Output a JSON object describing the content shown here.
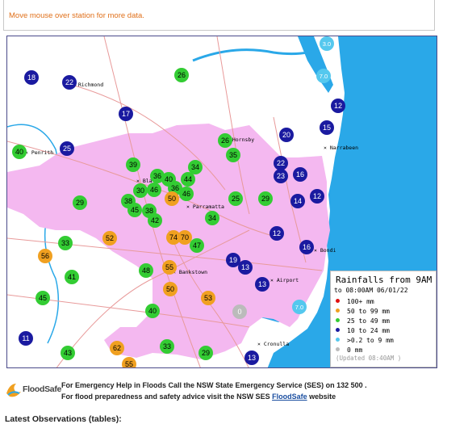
{
  "hint": "Move mouse over station for more data.",
  "map": {
    "places": [
      {
        "name": "Richmond",
        "label": "Richmond"
      },
      {
        "name": "Penrith",
        "label": "Penrith"
      },
      {
        "name": "Hornsby",
        "label": "Hornsby"
      },
      {
        "name": "Narrabeen",
        "label": "Narrabeen"
      },
      {
        "name": "Blacktown",
        "label": "Bla"
      },
      {
        "name": "Parramatta",
        "label": "Parramatta"
      },
      {
        "name": "Bankstown",
        "label": "Bankstown"
      },
      {
        "name": "Bondi",
        "label": "Bondi"
      },
      {
        "name": "Airport",
        "label": "Airport"
      },
      {
        "name": "Cronulla",
        "label": "Cronulla"
      }
    ],
    "stations": [
      {
        "value": "18",
        "category": "10-24"
      },
      {
        "value": "22",
        "category": "10-24"
      },
      {
        "value": "26",
        "category": "25-49"
      },
      {
        "value": "3.0",
        "category": "0.2-9"
      },
      {
        "value": "7.0",
        "category": "0.2-9"
      },
      {
        "value": "17",
        "category": "10-24"
      },
      {
        "value": "12",
        "category": "10-24"
      },
      {
        "value": "15",
        "category": "10-24"
      },
      {
        "value": "20",
        "category": "10-24"
      },
      {
        "value": "40",
        "category": "25-49"
      },
      {
        "value": "25",
        "category": "10-24"
      },
      {
        "value": "26",
        "category": "25-49"
      },
      {
        "value": "35",
        "category": "25-49"
      },
      {
        "value": "39",
        "category": "25-49"
      },
      {
        "value": "34",
        "category": "25-49"
      },
      {
        "value": "22",
        "category": "10-24"
      },
      {
        "value": "23",
        "category": "10-24"
      },
      {
        "value": "16",
        "category": "10-24"
      },
      {
        "value": "36",
        "category": "25-49"
      },
      {
        "value": "40",
        "category": "25-49"
      },
      {
        "value": "44",
        "category": "25-49"
      },
      {
        "value": "30",
        "category": "25-49"
      },
      {
        "value": "46",
        "category": "25-49"
      },
      {
        "value": "36",
        "category": "25-49"
      },
      {
        "value": "46",
        "category": "25-49"
      },
      {
        "value": "50",
        "category": "50-99"
      },
      {
        "value": "38",
        "category": "25-49"
      },
      {
        "value": "29",
        "category": "25-49"
      },
      {
        "value": "25",
        "category": "25-49"
      },
      {
        "value": "29",
        "category": "25-49"
      },
      {
        "value": "14",
        "category": "10-24"
      },
      {
        "value": "12",
        "category": "10-24"
      },
      {
        "value": "45",
        "category": "25-49"
      },
      {
        "value": "38",
        "category": "25-49"
      },
      {
        "value": "42",
        "category": "25-49"
      },
      {
        "value": "34",
        "category": "25-49"
      },
      {
        "value": "33",
        "category": "25-49"
      },
      {
        "value": "52",
        "category": "50-99"
      },
      {
        "value": "74",
        "category": "50-99"
      },
      {
        "value": "70",
        "category": "50-99"
      },
      {
        "value": "47",
        "category": "25-49"
      },
      {
        "value": "12",
        "category": "10-24"
      },
      {
        "value": "16",
        "category": "10-24"
      },
      {
        "value": "56",
        "category": "50-99"
      },
      {
        "value": "48",
        "category": "25-49"
      },
      {
        "value": "55",
        "category": "50-99"
      },
      {
        "value": "19",
        "category": "10-24"
      },
      {
        "value": "13",
        "category": "10-24"
      },
      {
        "value": "41",
        "category": "25-49"
      },
      {
        "value": "50",
        "category": "50-99"
      },
      {
        "value": "13",
        "category": "10-24"
      },
      {
        "value": "45",
        "category": "25-49"
      },
      {
        "value": "53",
        "category": "50-99"
      },
      {
        "value": "7.0",
        "category": "0.2-9"
      },
      {
        "value": "40",
        "category": "25-49"
      },
      {
        "value": "0",
        "category": "0"
      },
      {
        "value": "11",
        "category": "10-24"
      },
      {
        "value": "43",
        "category": "25-49"
      },
      {
        "value": "62",
        "category": "50-99"
      },
      {
        "value": "33",
        "category": "25-49"
      },
      {
        "value": "29",
        "category": "25-49"
      },
      {
        "value": "13",
        "category": "10-24"
      },
      {
        "value": "55",
        "category": "50-99"
      }
    ]
  },
  "legend": {
    "title": "Rainfalls from 9AM",
    "subtitle": "to 08:00AM 06/01/22",
    "rows": [
      {
        "label": "100+ mm",
        "color": "#e01010"
      },
      {
        "label": "50  to 99 mm",
        "color": "#f0a020"
      },
      {
        "label": "25  to 49 mm",
        "color": "#33cc33"
      },
      {
        "label": "10  to 24 mm",
        "color": "#1a1aa0"
      },
      {
        "label": ">0.2 to 9 mm",
        "color": "#55c8ee"
      },
      {
        "label": "0 mm",
        "color": "#bbbbbb"
      }
    ],
    "updated": "(Updated 08:40AM  )"
  },
  "colors": {
    "ocean": "#2aa8e8",
    "urban": "#f4b8f0",
    "roads": "#e89a9a",
    "rivers": "#2aa8e8",
    "mm_50_99": "#f0a020",
    "mm_25_49": "#33cc33",
    "mm_10_24": "#1a1aa0",
    "mm_0_2_9": "#55c8ee",
    "mm_0": "#bbbbbb"
  },
  "footer": {
    "logo_word": "FloodSafe",
    "line1": "For Emergency Help in Floods Call the NSW State Emergency Service (SES) on 132 500 .",
    "line2_prefix": "For flood preparedness and safety advice visit the NSW SES ",
    "line2_link": "FloodSafe",
    "line2_suffix": " website",
    "latest": "Latest Observations (tables):"
  }
}
